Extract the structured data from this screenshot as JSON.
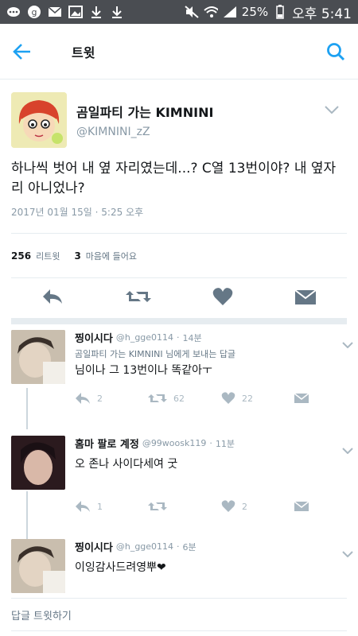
{
  "status": {
    "battery": "25%",
    "time": "오후 5:41"
  },
  "header": {
    "title": "트윗"
  },
  "tweet": {
    "display_name": "곰일파티 가는 KIMNINI",
    "handle": "@KIMNINI_zZ",
    "text": "하나씩 벗어 내 옆 자리였는데...? C열 13번이야? 내 옆자리 아니었나?",
    "timestamp": "2017년 01월 15일 · 5:25 오후",
    "retweets": "256",
    "retweets_label": "리트윗",
    "likes": "3",
    "likes_label": "마음에 들어요"
  },
  "replies": [
    {
      "name": "찡이시다",
      "handle": "@h_gge0114",
      "time": "14분",
      "to": "곰일파티 가는 KIMNINI 님에게 보내는 답글",
      "text": "님이나 그 13번이나 똑같아ㅜ",
      "replies": "2",
      "retweets": "62",
      "likes": "22"
    },
    {
      "name": "홈마 팔로 계정",
      "handle": "@99woosk119",
      "time": "11분",
      "to": "",
      "text": "오 존나 사이다세여 굿",
      "replies": "1",
      "retweets": "",
      "likes": "2"
    },
    {
      "name": "찡이시다",
      "handle": "@h_gge0114",
      "time": "6분",
      "to": "",
      "text": "이잉감사드려영뿌❤"
    }
  ],
  "compose": {
    "placeholder": "답글 트윗하기"
  },
  "colors": {
    "accent": "#1da1f2",
    "muted": "#8899a6",
    "icon": "#657786"
  }
}
